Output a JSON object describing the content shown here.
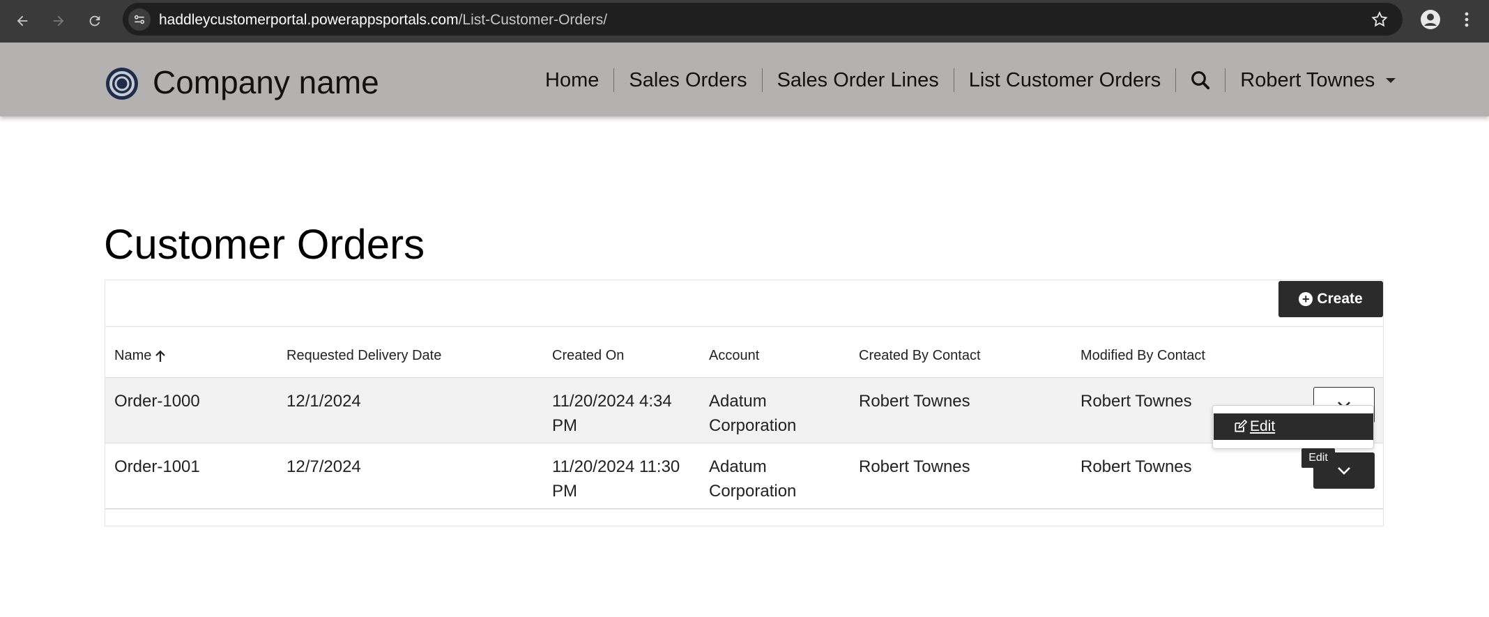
{
  "browser": {
    "url_host": "haddleycustomerportal.powerappsportals.com",
    "url_path": "/List-Customer-Orders/"
  },
  "header": {
    "brand": "Company name",
    "nav": [
      "Home",
      "Sales Orders",
      "Sales Order Lines",
      "List Customer Orders"
    ],
    "user": "Robert Townes"
  },
  "page": {
    "title": "Customer Orders",
    "create_label": "Create"
  },
  "table": {
    "columns": [
      "Name",
      "Requested Delivery Date",
      "Created On",
      "Account",
      "Created By Contact",
      "Modified By Contact"
    ],
    "rows": [
      {
        "name": "Order-1000",
        "delivery": "12/1/2024",
        "created_on": "11/20/2024 4:34 PM",
        "account": "Adatum Corporation",
        "created_by": "Robert Townes",
        "modified_by": "Robert Townes"
      },
      {
        "name": "Order-1001",
        "delivery": "12/7/2024",
        "created_on": "11/20/2024 11:30 PM",
        "account": "Adatum Corporation",
        "created_by": "Robert Townes",
        "modified_by": "Robert Townes"
      }
    ]
  },
  "row_menu": {
    "edit_label": "Edit",
    "tooltip": "Edit"
  },
  "colors": {
    "header_bg": "#b3b2b1",
    "button_dark": "#2b2b2b",
    "row_alt": "#f2f2f2"
  }
}
